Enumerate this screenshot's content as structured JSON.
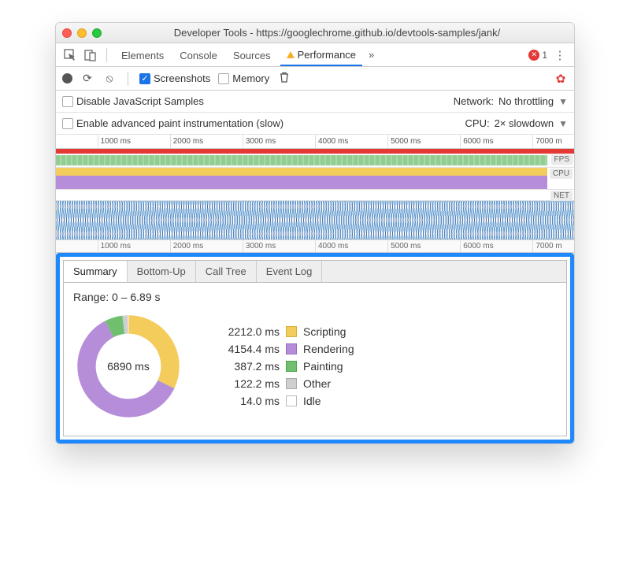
{
  "window": {
    "title": "Developer Tools - https://googlechrome.github.io/devtools-samples/jank/"
  },
  "main_tabs": {
    "inspect_icon": "inspect",
    "device_icon": "device-toggle",
    "items": [
      "Elements",
      "Console",
      "Sources",
      "Performance"
    ],
    "more_indicator": "»",
    "error_count": "1"
  },
  "controls": {
    "record_title": "Record",
    "reload_title": "Reload",
    "clear_title": "Clear",
    "screenshots_label": "Screenshots",
    "screenshots_checked": true,
    "memory_label": "Memory",
    "memory_checked": false,
    "gc_title": "Collect garbage",
    "settings_title": "Settings"
  },
  "settings": {
    "disable_js_label": "Disable JavaScript Samples",
    "network_label": "Network:",
    "network_value": "No throttling",
    "adv_paint_label": "Enable advanced paint instrumentation (slow)",
    "cpu_label": "CPU:",
    "cpu_value": "2× slowdown"
  },
  "timeline": {
    "ticks_ms": [
      "1000 ms",
      "2000 ms",
      "3000 ms",
      "4000 ms",
      "5000 ms",
      "6000 ms",
      "7000 m"
    ],
    "lanes": {
      "fps": "FPS",
      "cpu": "CPU",
      "net": "NET"
    },
    "bottom_ticks": [
      "1000 ms",
      "2000 ms",
      "3000 ms",
      "4000 ms",
      "5000 ms",
      "6000 ms",
      "7000 m"
    ]
  },
  "bottom_tabs": [
    "Summary",
    "Bottom-Up",
    "Call Tree",
    "Event Log"
  ],
  "summary": {
    "range_label": "Range: 0 – 6.89 s",
    "total_label": "6890 ms"
  },
  "chart_data": {
    "type": "pie",
    "unit": "ms",
    "title": "Summary",
    "total": 6890,
    "series": [
      {
        "name": "Scripting",
        "value": 2212.0,
        "label": "2212.0 ms",
        "color": "#f3cc5c"
      },
      {
        "name": "Rendering",
        "value": 4154.4,
        "label": "4154.4 ms",
        "color": "#b58dd8"
      },
      {
        "name": "Painting",
        "value": 387.2,
        "label": "387.2 ms",
        "color": "#6fbf6f"
      },
      {
        "name": "Other",
        "value": 122.2,
        "label": "122.2 ms",
        "color": "#cfcfcf"
      },
      {
        "name": "Idle",
        "value": 14.0,
        "label": "14.0 ms",
        "color": "#ffffff"
      }
    ]
  }
}
